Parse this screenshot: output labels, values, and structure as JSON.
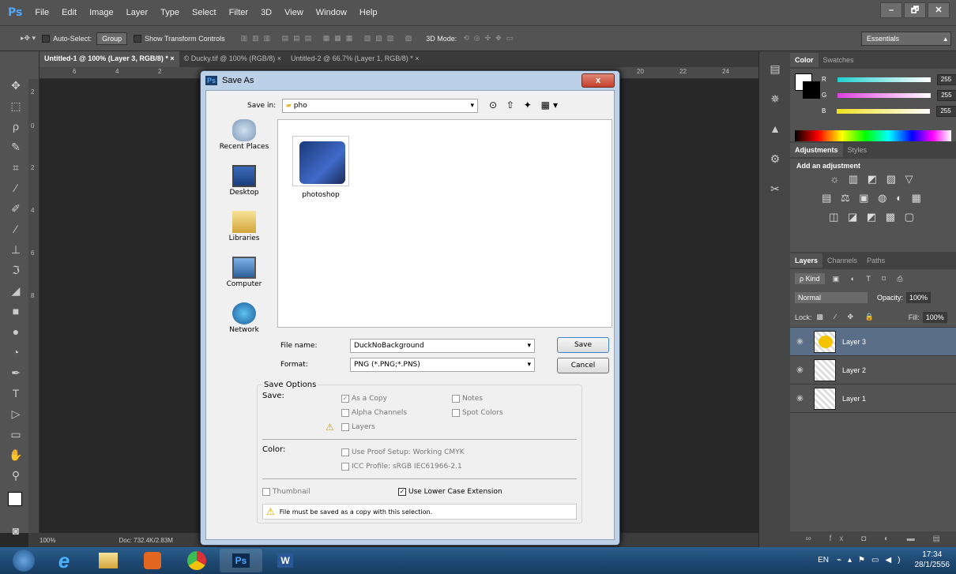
{
  "app": {
    "logo": "Ps",
    "menu": [
      "File",
      "Edit",
      "Image",
      "Layer",
      "Type",
      "Select",
      "Filter",
      "3D",
      "View",
      "Window",
      "Help"
    ],
    "window_controls": [
      "–",
      "🗗",
      "✕"
    ]
  },
  "options_bar": {
    "auto_select": "Auto-Select:",
    "group": "Group",
    "show_transform": "Show Transform Controls",
    "mode3d": "3D Mode:",
    "workspace": "Essentials"
  },
  "tabs": [
    "Untitled-1 @ 100% (Layer 3, RGB/8) *",
    "© Ducky.tif @ 100% (RGB/8)",
    "Untitled-2 @ 66.7% (Layer 1, RGB/8) *"
  ],
  "ruler_top": [
    "6",
    "4",
    "2",
    "20",
    "22",
    "24"
  ],
  "ruler_left": [
    "2",
    "0",
    "2",
    "4",
    "6",
    "8"
  ],
  "status": {
    "zoom": "100%",
    "doc": "Doc: 732.4K/2.83M"
  },
  "color_panel": {
    "tabs": [
      "Color",
      "Swatches"
    ],
    "rows": [
      {
        "label": "R",
        "value": "255",
        "color": "#20d0d0"
      },
      {
        "label": "G",
        "value": "255",
        "color": "#e040e0"
      },
      {
        "label": "B",
        "value": "255",
        "color": "#f0e020"
      }
    ]
  },
  "adjustments": {
    "tabs": [
      "Adjustments",
      "Styles"
    ],
    "heading": "Add an adjustment",
    "icon_rows": [
      "☼ ▥ ◩ ▨ ▽",
      "▤ ⚖ ▣ ◍ ◐ ▦",
      "◫ ◪ ◩ ▩ ▢"
    ]
  },
  "layers_panel": {
    "tabs": [
      "Layers",
      "Channels",
      "Paths"
    ],
    "kind": "ρ Kind",
    "blend": "Normal",
    "opacity_label": "Opacity:",
    "opacity": "100%",
    "lock_label": "Lock:",
    "fill_label": "Fill:",
    "fill": "100%",
    "layers": [
      "Layer 3",
      "Layer 2",
      "Layer 1"
    ]
  },
  "taskbar": {
    "lang": "EN",
    "time": "17:34",
    "date": "28/1/2556"
  },
  "dialog": {
    "title": "Save As",
    "close": "x",
    "save_in_label": "Save in:",
    "save_in": "pho",
    "places": [
      "Recent Places",
      "Desktop",
      "Libraries",
      "Computer",
      "Network"
    ],
    "file": "photoshop",
    "file_name_label": "File name:",
    "file_name": "DuckNoBackground",
    "format_label": "Format:",
    "format": "PNG (*.PNG;*.PNS)",
    "save": "Save",
    "cancel": "Cancel",
    "save_options": "Save Options",
    "save_label": "Save:",
    "as_copy": "As a Copy",
    "notes": "Notes",
    "alpha": "Alpha Channels",
    "spot": "Spot Colors",
    "layers": "Layers",
    "color_label": "Color:",
    "proof": "Use Proof Setup:  Working CMYK",
    "icc": "ICC Profile:  sRGB IEC61966-2.1",
    "thumbnail": "Thumbnail",
    "lowercase": "Use Lower Case Extension",
    "warning": "File must be saved as a copy with this selection."
  }
}
